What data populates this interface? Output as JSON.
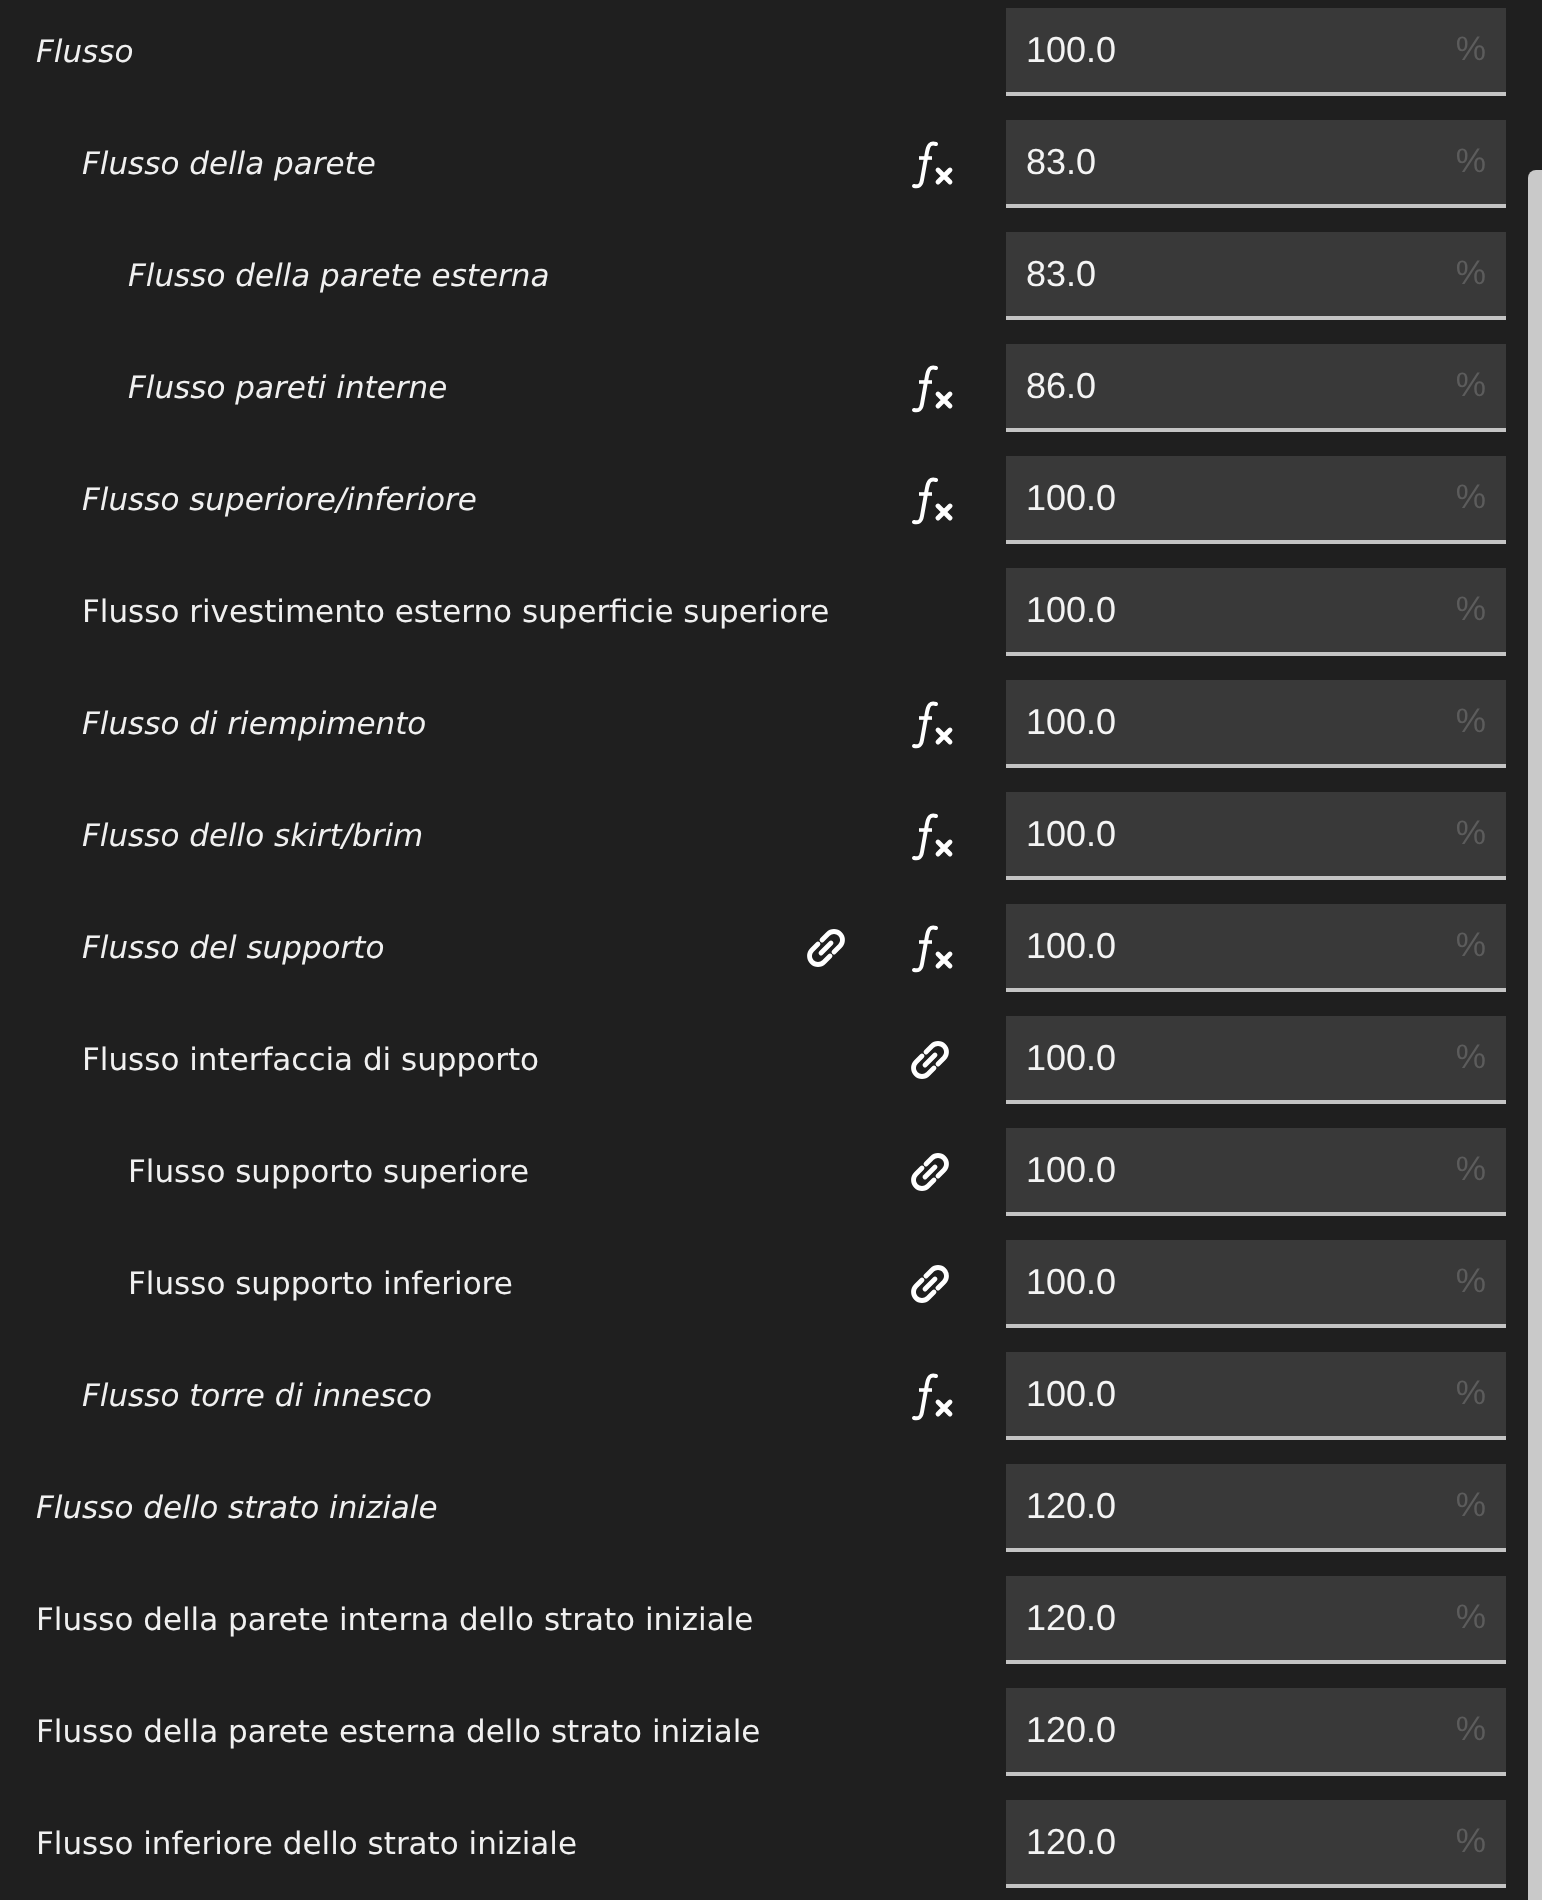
{
  "settings": [
    {
      "label": "Flusso",
      "overridden": true,
      "value": "100.0",
      "unit": "%",
      "linked": false,
      "formula": false,
      "children": [
        {
          "label": "Flusso della parete",
          "overridden": true,
          "value": "83.0",
          "unit": "%",
          "linked": false,
          "formula": true,
          "children": [
            {
              "label": "Flusso della parete esterna",
              "overridden": true,
              "value": "83.0",
              "unit": "%",
              "linked": false,
              "formula": false
            },
            {
              "label": "Flusso pareti interne",
              "overridden": true,
              "value": "86.0",
              "unit": "%",
              "linked": false,
              "formula": true
            }
          ]
        },
        {
          "label": "Flusso superiore/inferiore",
          "overridden": true,
          "value": "100.0",
          "unit": "%",
          "linked": false,
          "formula": true
        },
        {
          "label": "Flusso rivestimento esterno superficie superiore",
          "overridden": false,
          "value": "100.0",
          "unit": "%",
          "linked": false,
          "formula": false
        },
        {
          "label": "Flusso di riempimento",
          "overridden": true,
          "value": "100.0",
          "unit": "%",
          "linked": false,
          "formula": true
        },
        {
          "label": "Flusso dello skirt/brim",
          "overridden": true,
          "value": "100.0",
          "unit": "%",
          "linked": false,
          "formula": true
        },
        {
          "label": "Flusso del supporto",
          "overridden": true,
          "value": "100.0",
          "unit": "%",
          "linked": true,
          "formula": true
        },
        {
          "label": "Flusso interfaccia di supporto",
          "overridden": false,
          "value": "100.0",
          "unit": "%",
          "linked": true,
          "formula": false,
          "children": [
            {
              "label": "Flusso supporto superiore",
              "overridden": false,
              "value": "100.0",
              "unit": "%",
              "linked": true,
              "formula": false
            },
            {
              "label": "Flusso supporto inferiore",
              "overridden": false,
              "value": "100.0",
              "unit": "%",
              "linked": true,
              "formula": false
            }
          ]
        },
        {
          "label": "Flusso torre di innesco",
          "overridden": true,
          "value": "100.0",
          "unit": "%",
          "linked": false,
          "formula": true
        }
      ]
    },
    {
      "label": "Flusso dello strato iniziale",
      "overridden": true,
      "value": "120.0",
      "unit": "%",
      "linked": false,
      "formula": false
    },
    {
      "label": "Flusso della parete interna dello strato iniziale",
      "overridden": false,
      "value": "120.0",
      "unit": "%",
      "linked": false,
      "formula": false
    },
    {
      "label": "Flusso della parete esterna dello strato iniziale",
      "overridden": false,
      "value": "120.0",
      "unit": "%",
      "linked": false,
      "formula": false
    },
    {
      "label": "Flusso inferiore dello strato iniziale",
      "overridden": false,
      "value": "120.0",
      "unit": "%",
      "linked": false,
      "formula": false
    }
  ]
}
